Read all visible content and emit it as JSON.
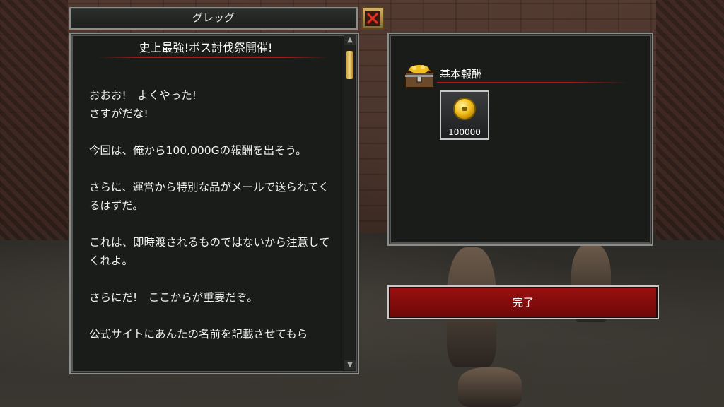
{
  "dialog": {
    "npc_name": "グレッグ",
    "heading": "史上最強!ボス討伐祭開催!",
    "body": "おおお!　よくやった!\nさすがだな!\n\n今回は、俺から100,000Gの報酬を出そう。\n\nさらに、運営から特別な品がメールで送られてくるはずだ。\n\nこれは、即時渡されるものではないから注意してくれよ。\n\nさらにだ!　ここからが重要だぞ。\n\n公式サイトにあんたの名前を記載させてもら"
  },
  "reward": {
    "title": "基本報酬",
    "items": [
      {
        "icon": "gold-coin-icon",
        "quantity": "100000"
      }
    ]
  },
  "actions": {
    "complete_label": "完了"
  },
  "scrollbar": {
    "up_glyph": "▲",
    "down_glyph": "▼"
  }
}
